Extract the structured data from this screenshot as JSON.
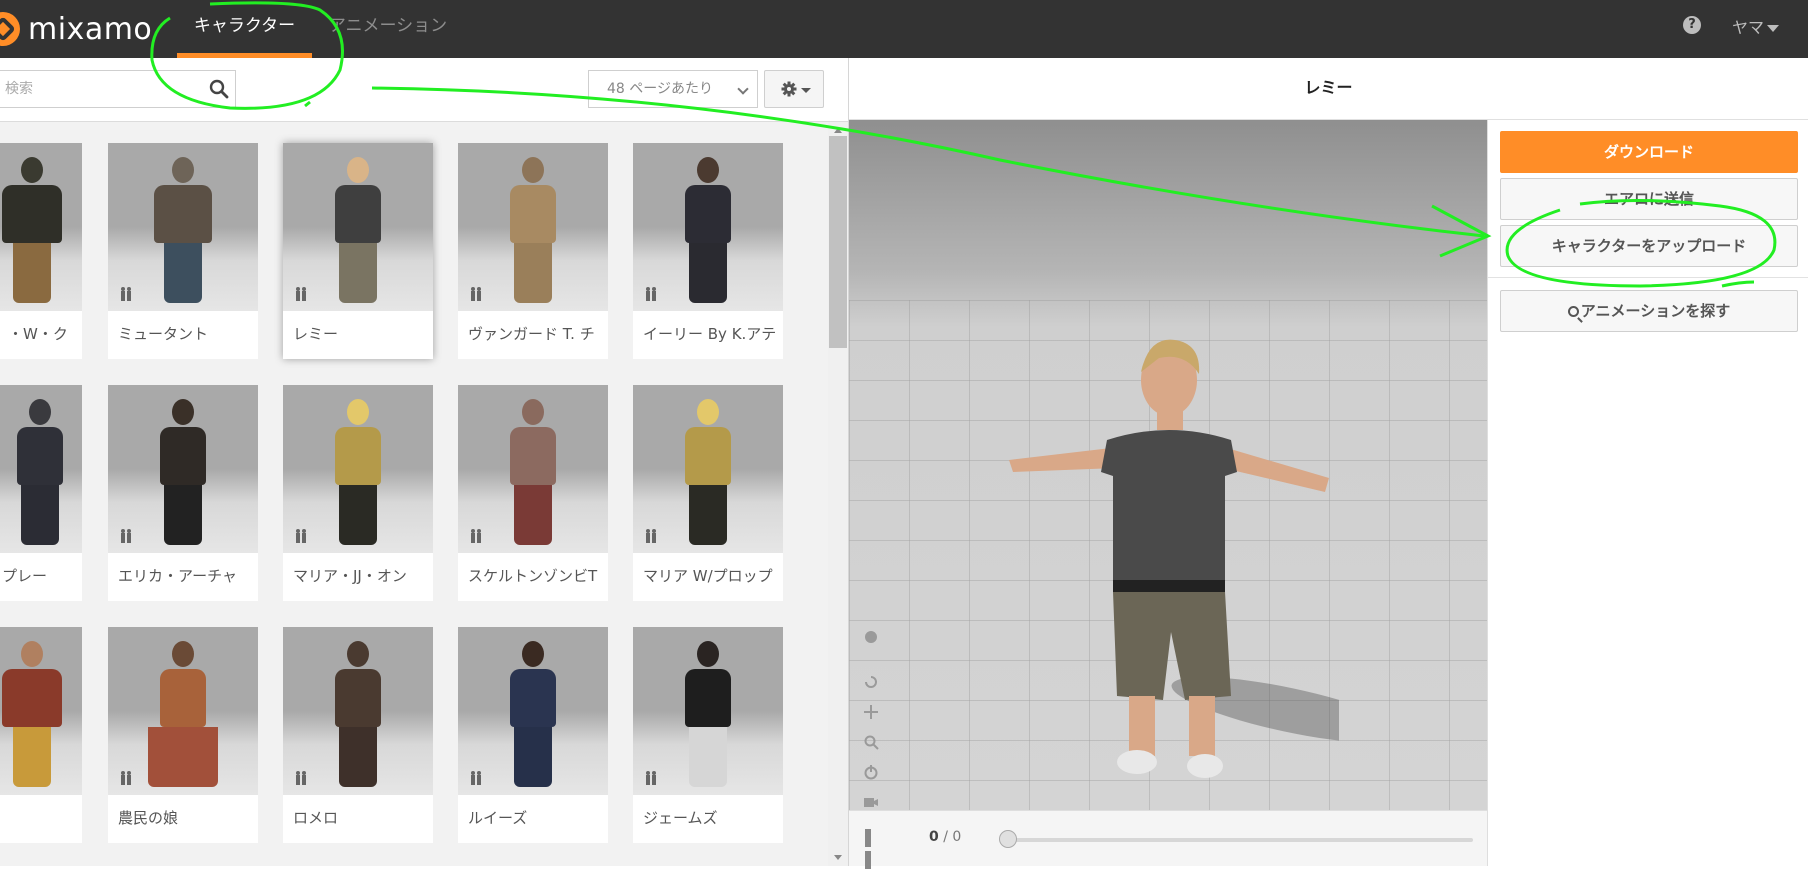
{
  "app": {
    "logo_text": "mixamo"
  },
  "nav": {
    "tabs": [
      {
        "label": "キャラクター",
        "active": true
      },
      {
        "label": "アニメーション",
        "active": false
      }
    ],
    "help_icon": "?",
    "user_label": "ヤマ"
  },
  "toolbar": {
    "search_placeholder": "検索",
    "per_page_label": "48 ページあたり",
    "settings_icon": "gear-icon"
  },
  "characters": [
    {
      "label": "・W・ク"
    },
    {
      "label": "ミュータント"
    },
    {
      "label": "レミー",
      "selected": true
    },
    {
      "label": "ヴァンガード T. チ"
    },
    {
      "label": "イーリー By K.アテ"
    },
    {
      "label": "プレー"
    },
    {
      "label": "エリカ・アーチャ"
    },
    {
      "label": "マリア・JJ・オン"
    },
    {
      "label": "スケルトンゾンビT"
    },
    {
      "label": "マリア W/プロップ"
    },
    {
      "label": ""
    },
    {
      "label": "農民の娘"
    },
    {
      "label": "ロメロ"
    },
    {
      "label": "ルイーズ"
    },
    {
      "label": "ジェームズ"
    }
  ],
  "viewer": {
    "title": "レミー",
    "frame_current": "0",
    "frame_sep": " / ",
    "frame_total": "0"
  },
  "actions": {
    "download": "ダウンロード",
    "send_to_aero": "エアロに送信",
    "upload_character": "キャラクターをアップロード",
    "find_animations": "アニメーションを探す"
  },
  "colors": {
    "accent": "#ff8d27",
    "topbar": "#333333",
    "annotation": "#22ee22"
  }
}
